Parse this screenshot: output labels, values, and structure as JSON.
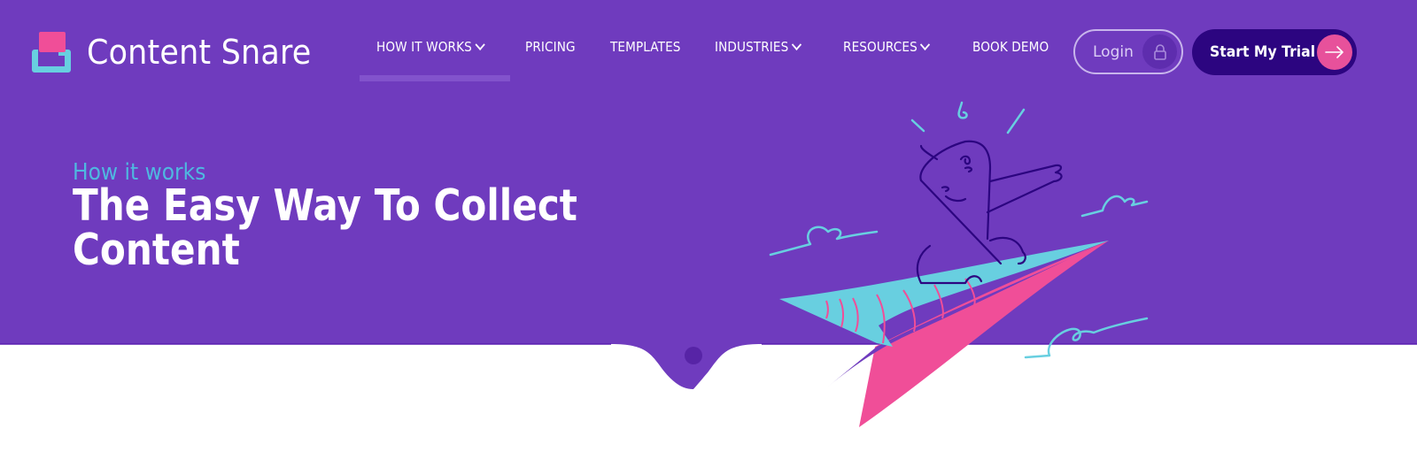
{
  "brand": {
    "name": "Content Snare",
    "colors": {
      "header_bg": "#6F3BBE",
      "accent_pink": "#F04E98",
      "accent_cyan": "#68CFE0",
      "dark_purple": "#2C0580",
      "eyebrow": "#4FB8E0"
    }
  },
  "nav": {
    "items": [
      {
        "label": "HOW IT WORKS",
        "has_dropdown": true,
        "active": true
      },
      {
        "label": "PRICING",
        "has_dropdown": false
      },
      {
        "label": "TEMPLATES",
        "has_dropdown": false
      },
      {
        "label": "INDUSTRIES",
        "has_dropdown": true
      },
      {
        "label": "RESOURCES",
        "has_dropdown": true
      },
      {
        "label": "BOOK DEMO",
        "has_dropdown": false
      }
    ],
    "login": {
      "label": "Login",
      "icon": "lock-icon"
    },
    "cta": {
      "label": "Start My Trial",
      "icon": "arrow-right-icon"
    }
  },
  "hero": {
    "eyebrow": "How it works",
    "title": "The Easy Way To Collect Content",
    "illustration": "person-riding-paper-plane"
  }
}
